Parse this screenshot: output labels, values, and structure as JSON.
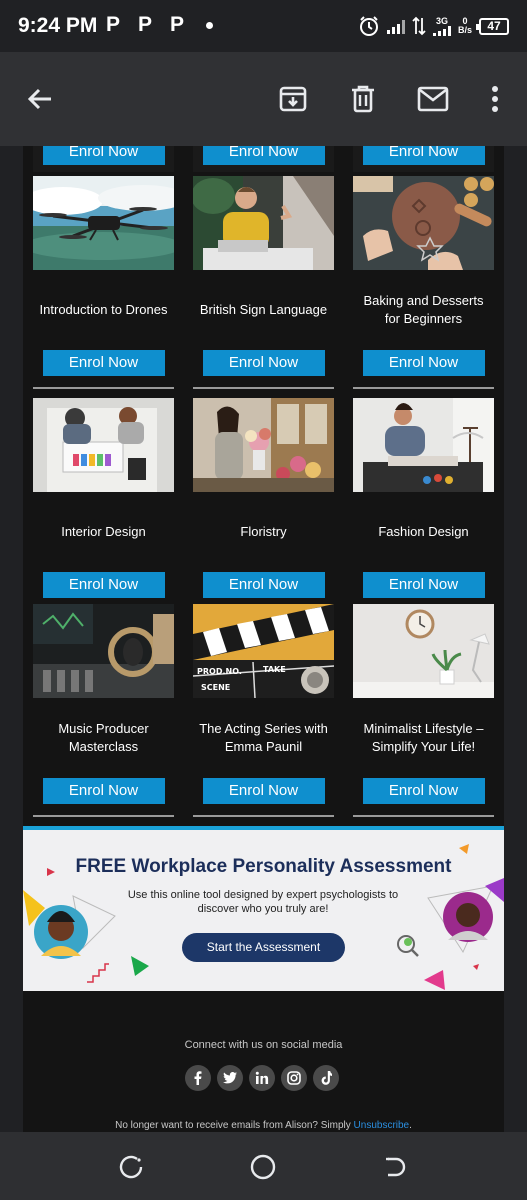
{
  "status": {
    "time": "9:24 PM",
    "p1": "P",
    "p2": "P",
    "p3": "P",
    "net_type": "3G",
    "speed_value": "0",
    "speed_unit": "B/s",
    "battery": "47"
  },
  "appbar": {
    "icons": [
      "back-arrow-icon",
      "archive-icon",
      "delete-icon",
      "mail-icon",
      "more-vert-icon"
    ]
  },
  "top_row": {
    "enrol_label": "Enrol Now"
  },
  "courses": [
    {
      "title": "Introduction to Drones",
      "enrol": "Enrol Now"
    },
    {
      "title": "British Sign Language",
      "enrol": "Enrol Now"
    },
    {
      "title": "Baking and Desserts for Beginners",
      "enrol": "Enrol Now"
    },
    {
      "title": "Interior Design",
      "enrol": "Enrol Now"
    },
    {
      "title": "Floristry",
      "enrol": "Enrol Now"
    },
    {
      "title": "Fashion Design",
      "enrol": "Enrol Now"
    },
    {
      "title": "Music Producer Masterclass",
      "enrol": "Enrol Now"
    },
    {
      "title": "The Acting Series with Emma Paunil",
      "enrol": "Enrol Now"
    },
    {
      "title": "Minimalist Lifestyle – Simplify Your Life!",
      "enrol": "Enrol Now"
    }
  ],
  "banner": {
    "title": "FREE Workplace Personality Assessment",
    "subtitle": "Use this online tool designed by expert psychologists to discover who you truly are!",
    "button": "Start the Assessment",
    "clapper_text1": "PROD.NO.",
    "clapper_text2": "TAKE",
    "clapper_text3": "SCENE"
  },
  "footer": {
    "connect": "Connect with us on social media",
    "socials": [
      "f",
      "t",
      "in",
      "ig",
      "tt"
    ],
    "unsubscribe_prefix": "No longer want to receive emails from Alison? Simply ",
    "unsubscribe_link": "Unsubscribe",
    "unsubscribe_suffix": "."
  },
  "colors": {
    "enrol_blue": "#0f8fce",
    "banner_accent": "#1aa2d8",
    "banner_title": "#1c2e5a"
  }
}
